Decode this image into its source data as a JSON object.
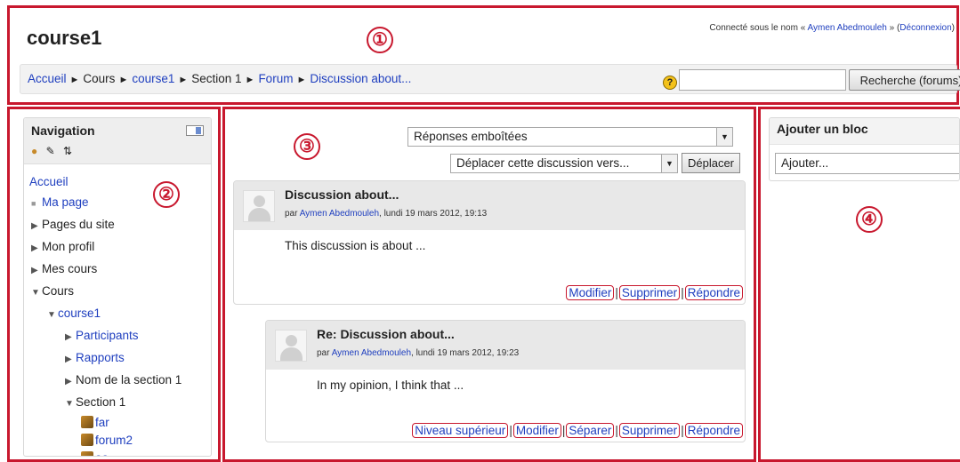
{
  "header": {
    "site_title": "course1",
    "login_prefix": "Connecté sous le nom « ",
    "user_name": "Aymen Abedmouleh",
    "login_middle": " » (",
    "logout_label": "Déconnexion",
    "login_suffix": ")"
  },
  "breadcrumb": {
    "items": [
      "Accueil",
      "Cours",
      "course1",
      "Section 1",
      "Forum",
      "Discussion about..."
    ],
    "separator": "►"
  },
  "search": {
    "value": "",
    "button_label": "Recherche (forums)",
    "help_glyph": "?"
  },
  "navigation": {
    "title": "Navigation",
    "tree": [
      {
        "label": "Accueil"
      },
      {
        "label": "Ma page"
      },
      {
        "label": "Pages du site"
      },
      {
        "label": "Mon profil"
      },
      {
        "label": "Mes cours"
      },
      {
        "label": "Cours"
      },
      {
        "label": "course1"
      },
      {
        "label": "Participants"
      },
      {
        "label": "Rapports"
      },
      {
        "label": "Nom de la section 1"
      },
      {
        "label": "Section 1"
      },
      {
        "label": "far"
      },
      {
        "label": "forum2"
      },
      {
        "label": "aa"
      }
    ]
  },
  "forum": {
    "display_mode": "Réponses emboîtées",
    "move_placeholder": "Déplacer cette discussion vers...",
    "move_button": "Déplacer",
    "posts": [
      {
        "subject": "Discussion about...",
        "by": "par ",
        "author": "Aymen Abedmouleh",
        "date": ", lundi 19 mars 2012, 19:13",
        "body": "This discussion is about ...",
        "commands": [
          "Modifier",
          "Supprimer",
          "Répondre"
        ]
      },
      {
        "subject": "Re: Discussion about...",
        "by": "par ",
        "author": "Aymen Abedmouleh",
        "date": ", lundi 19 mars 2012, 19:23",
        "body": "In my opinion, I think that ...",
        "commands": [
          "Niveau supérieur",
          "Modifier",
          "Séparer",
          "Supprimer",
          "Répondre"
        ]
      }
    ]
  },
  "add_block": {
    "title": "Ajouter un bloc",
    "select_value": "Ajouter..."
  },
  "annotations": {
    "one": "①",
    "two": "②",
    "three": "③",
    "four": "④"
  }
}
